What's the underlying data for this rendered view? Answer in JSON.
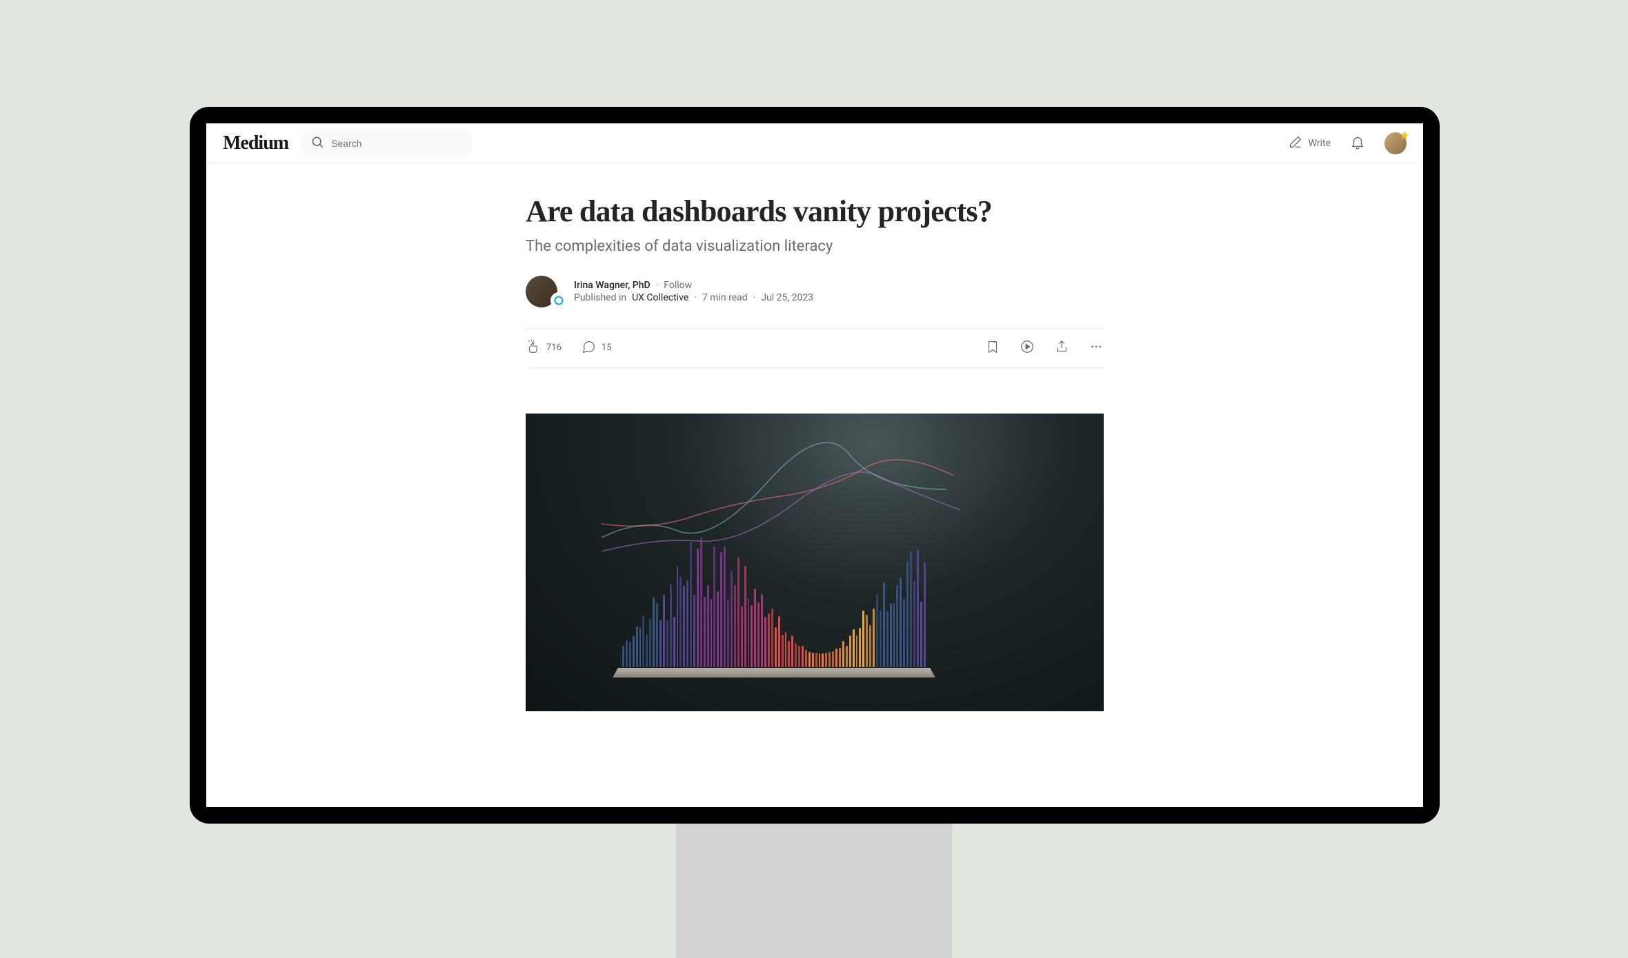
{
  "header": {
    "logo": "Medium",
    "search_placeholder": "Search",
    "write_label": "Write"
  },
  "article": {
    "title": "Are data dashboards vanity projects?",
    "subtitle": "The complexities of data visualization literacy",
    "author_name": "Irina Wagner, PhD",
    "follow_label": "Follow",
    "published_in_prefix": "Published in",
    "publication": "UX Collective",
    "read_time": "7 min read",
    "date": "Jul 25, 2023"
  },
  "stats": {
    "claps": "716",
    "responses": "15"
  }
}
